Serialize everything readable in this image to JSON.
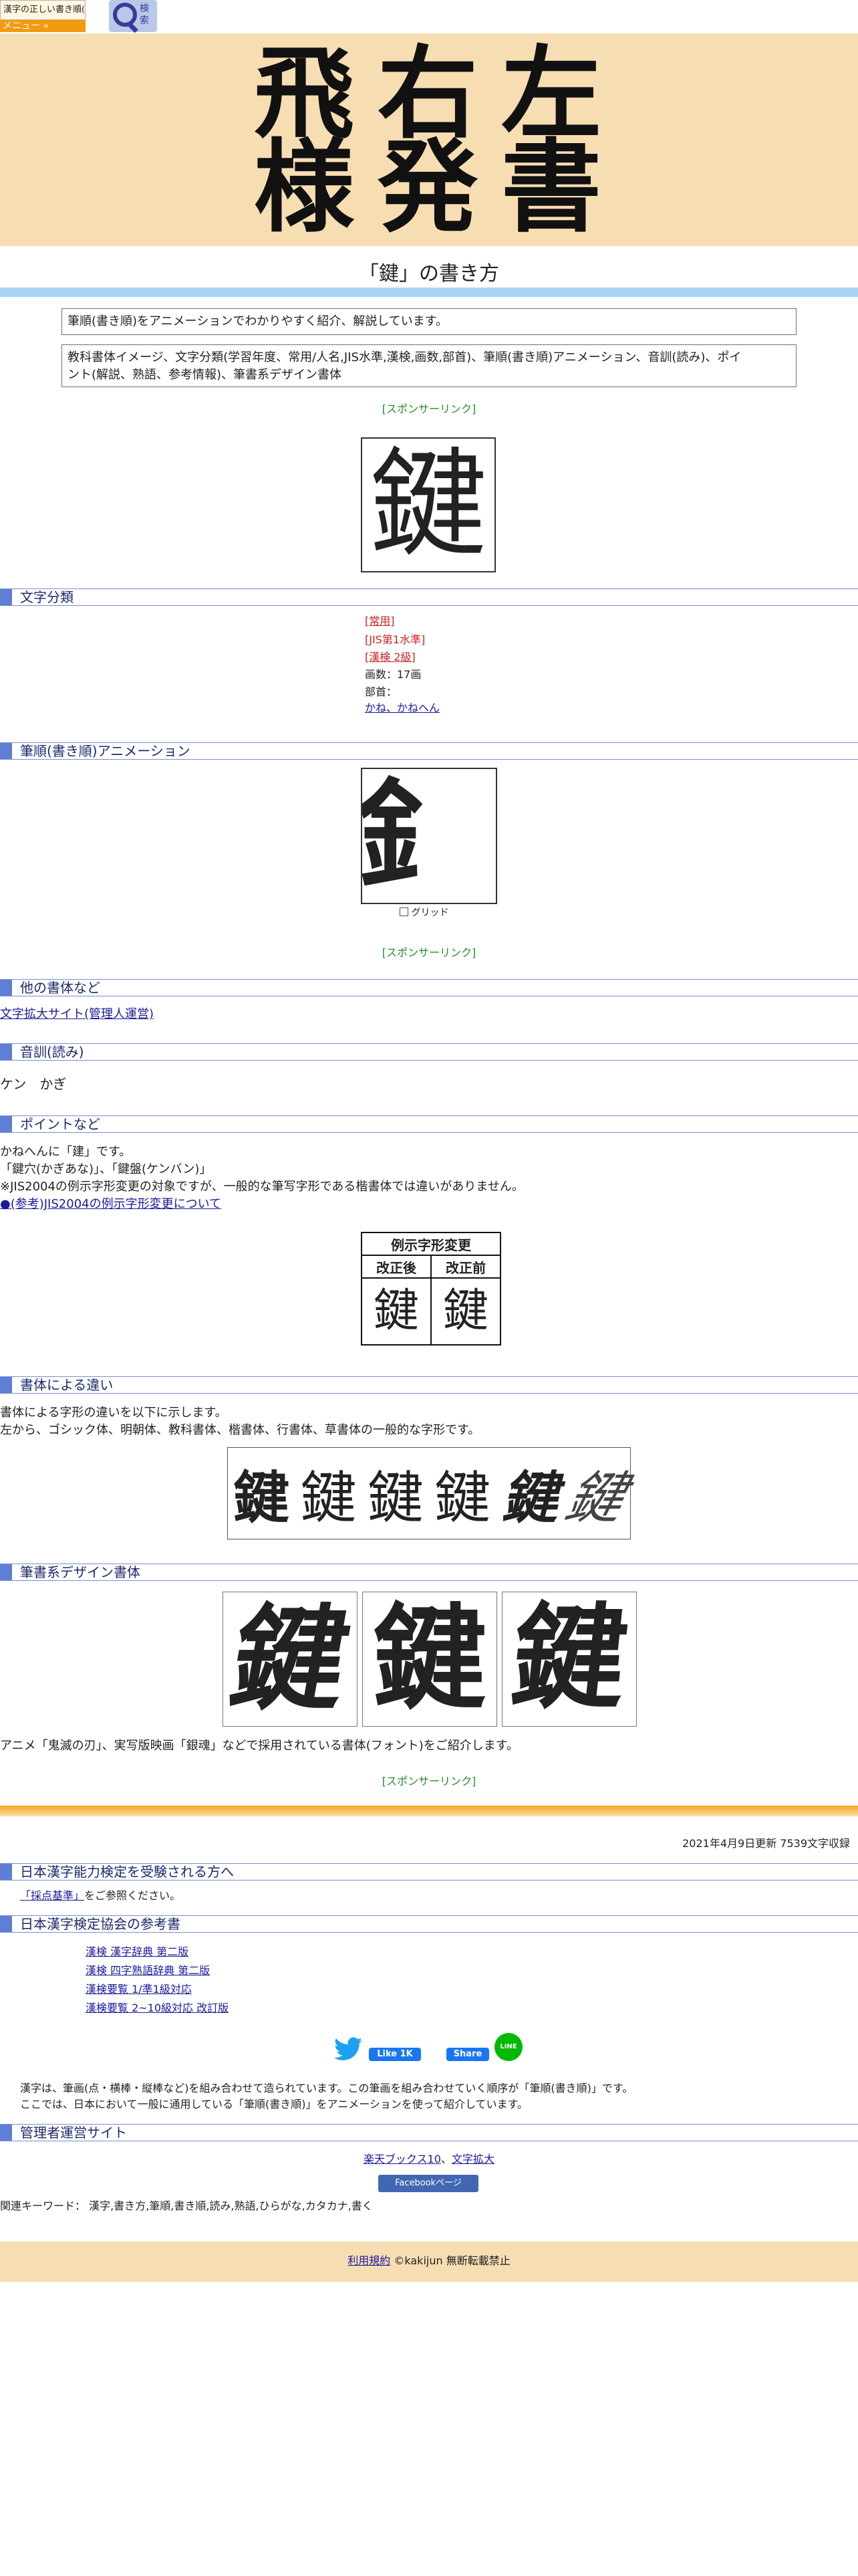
{
  "header": {
    "logo_text": "漢字の正しい書き順(筆順)",
    "menu_label": "メニュー »",
    "search_label": "検索"
  },
  "banner": {
    "chars": [
      "飛",
      "右",
      "左",
      "様",
      "発",
      "書"
    ]
  },
  "page_title": "「鍵」の書き方",
  "intro": {
    "line1": "筆順(書き順)をアニメーションでわかりやすく紹介、解説しています。",
    "line2a": "教科書体イメージ、文字分類(学習年度、常用/人名,JIS水準,漢検,画数,部首)、筆順(書き順)アニメーション、音訓(読み)、ポイ",
    "line2b": "ント(解説、熟語、参考情報)、筆書系デザイン書体"
  },
  "sponsor_label": "[スポンサーリンク]",
  "kanji": "鍵",
  "sections": {
    "classification": "文字分類",
    "animation": "筆順(書き順)アニメーション",
    "other_fonts": "他の書体など",
    "reading": "音訓(読み)",
    "points": "ポイントなど",
    "font_diff": "書体による違い",
    "brush": "筆書系デザイン書体"
  },
  "classification": {
    "joyo": "[常用]",
    "jis": "[JIS第1水準]",
    "kanken": "[漢検 2級]",
    "strokes": "画数：17画",
    "radical_label": "部首：",
    "radical_value": "かね、かねへん"
  },
  "animation": {
    "partial_glyph": "釒",
    "grid_label": "グリッド"
  },
  "other_fonts": {
    "link": "文字拡大サイト(管理人運営)"
  },
  "reading": {
    "text": "ケン　かぎ"
  },
  "points": {
    "line1": "かねへんに「建」です。",
    "line2": "「鍵穴(かぎあな)」、「鍵盤(ケンバン)」",
    "line3": "※JIS2004の例示字形変更の対象ですが、一般的な筆写字形である楷書体では違いがありません。",
    "line4": "●(参考)JIS2004の例示字形変更について"
  },
  "variant_table": {
    "title": "例示字形変更",
    "after": "改正後",
    "before": "改正前"
  },
  "font_diff": {
    "line1": "書体による字形の違いを以下に示します。",
    "line2": "左から、ゴシック体、明朝体、教科書体、楷書体、行書体、草書体の一般的な字形です。"
  },
  "brush": {
    "caption": "アニメ「鬼滅の刃」、実写版映画「銀魂」などで採用されている書体(フォント)をご紹介します。"
  },
  "footer": {
    "updated": "2021年4月9日更新 7539文字収録",
    "kanken_heading": "日本漢字能力検定を受験される方へ",
    "kanken_link": "「採点基準」",
    "kanken_suffix": "をご参照ください。",
    "assoc_heading": "日本漢字検定協会の参考書",
    "books": [
      "漢検 漢字辞典 第二版",
      "漢検 四字熟語辞典 第二版",
      "漢検要覧 1/準1級対応",
      "漢検要覧 2~10級対応 改訂版"
    ],
    "fb_like": "Like 1K",
    "fb_share": "Share",
    "line_label": "LINE",
    "note1": "漢字は、筆画(点・横棒・縦棒など)を組み合わせて造られています。この筆画を組み合わせていく順序が「筆順(書き順)」です。",
    "note2": "ここでは、日本において一般に通用している「筆順(書き順)」をアニメーションを使って紹介しています。",
    "admin_heading": "管理者運営サイト",
    "admin_link1": "楽天ブックス10",
    "admin_sep": "、",
    "admin_link2": "文字拡大",
    "fb_page": "Facebookページ",
    "keywords": "関連キーワード： 漢字,書き方,筆順,書き順,読み,熟語,ひらがな,カタカナ,書く",
    "terms": "利用規約",
    "copyright": "©kakijun 無断転載禁止"
  }
}
